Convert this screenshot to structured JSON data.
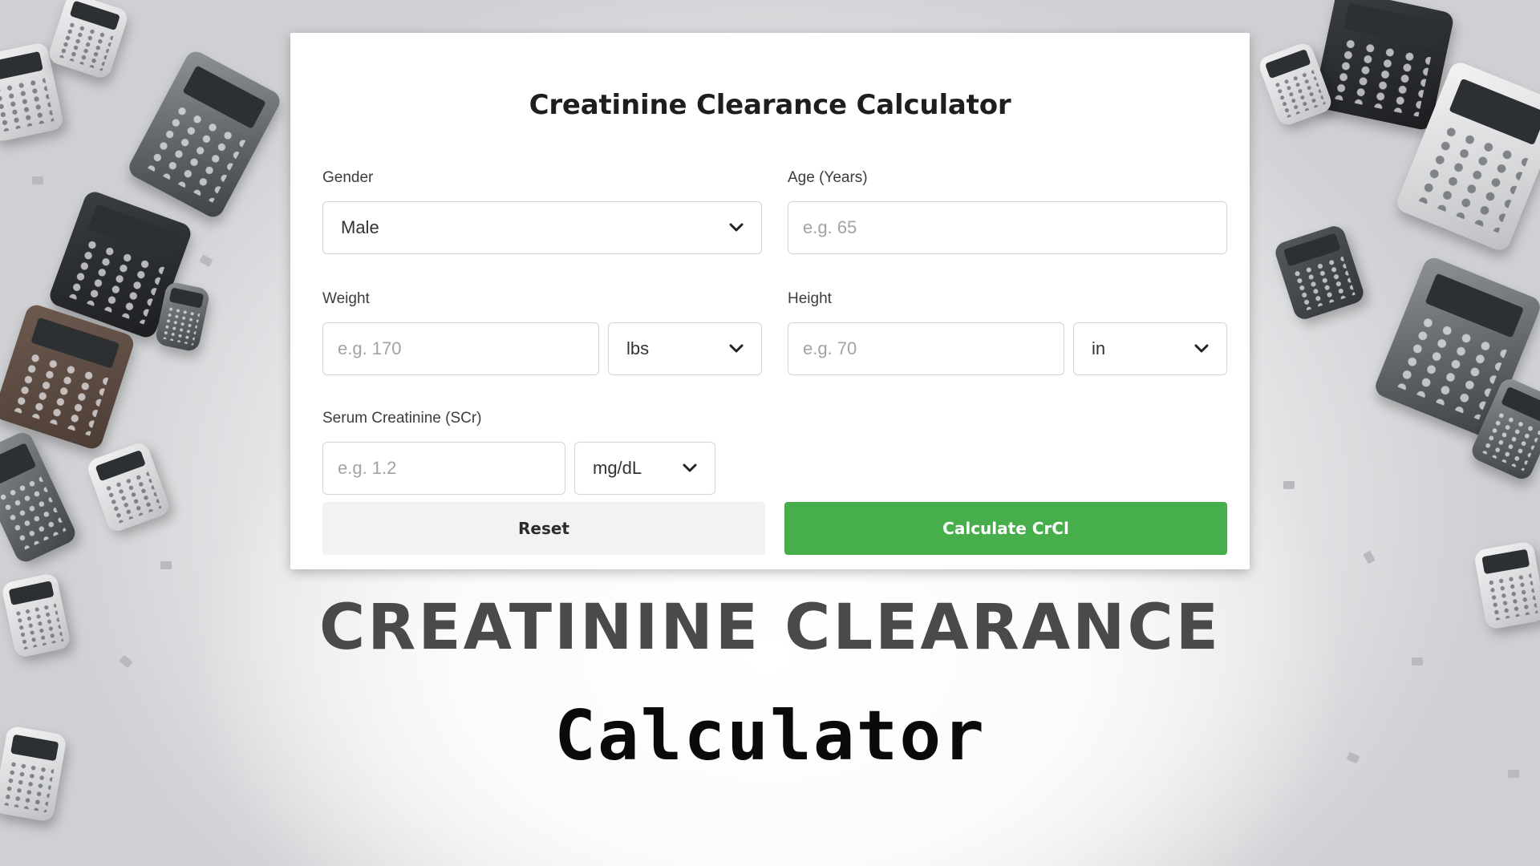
{
  "card": {
    "title": "Creatinine Clearance Calculator",
    "gender": {
      "label": "Gender",
      "selected": "Male",
      "icon": "chevron-down-icon"
    },
    "age": {
      "label": "Age (Years)",
      "value": "",
      "placeholder": "e.g. 65"
    },
    "weight": {
      "label": "Weight",
      "value": "",
      "placeholder": "e.g. 170",
      "unit": "lbs",
      "icon": "chevron-down-icon"
    },
    "height": {
      "label": "Height",
      "value": "",
      "placeholder": "e.g. 70",
      "unit": "in",
      "icon": "chevron-down-icon"
    },
    "scr": {
      "label": "Serum Creatinine (SCr)",
      "value": "",
      "placeholder": "e.g. 1.2",
      "unit": "mg/dL",
      "icon": "chevron-down-icon"
    },
    "buttons": {
      "reset": "Reset",
      "calculate": "Calculate CrCl"
    }
  },
  "banner": {
    "headline": "CREATININE CLEARANCE",
    "subline": "Calculator"
  },
  "colors": {
    "accent": "#46ae4a",
    "reset_bg": "#f2f2f2",
    "text": "#1e1e1e",
    "headline": "#4a4a4a"
  }
}
